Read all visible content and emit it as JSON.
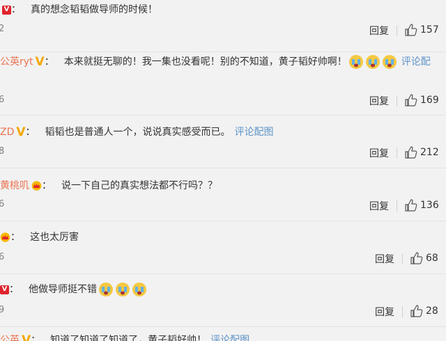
{
  "comments": [
    {
      "prefix": "",
      "badge": "red-v",
      "text": "真的想念韬韬做导师的时候！",
      "date": "2",
      "reply": "回复",
      "likes": "157"
    },
    {
      "prefix": "公英ryt",
      "badge": "v-check",
      "text": "本来就挺无聊的！我一集也没看呢！别的不知道，黄子韬好帅啊！",
      "emoji_count": 3,
      "pic_link": "评论配",
      "date": "6",
      "reply": "回复",
      "likes": "169"
    },
    {
      "prefix": "ZD",
      "badge": "v-check",
      "text": "韬韬也是普通人一个，说说真实感受而已。",
      "pic_link": "评论配图",
      "date": "8",
      "reply": "回复",
      "likes": "212"
    },
    {
      "prefix": "黄桃叽",
      "badge": "crown",
      "text": "说一下自己的真实想法都不行吗？？",
      "date": "6",
      "reply": "回复",
      "likes": "136"
    },
    {
      "prefix": "",
      "badge": "crown",
      "text": "这也太厉害",
      "date": "6",
      "reply": "回复",
      "likes": "68"
    },
    {
      "prefix": "",
      "badge": "red-v",
      "text": "他做导师挺不错",
      "emoji_count": 3,
      "date": "9",
      "reply": "回复",
      "likes": "28"
    }
  ],
  "partial_last": {
    "prefix": "公英",
    "text": "知道了知道了知道了，黄子韬好帅！",
    "pic_link": "评论配图"
  },
  "icons": {
    "like": "thumbs-up-icon",
    "emoji": "crying-face-icon",
    "crown": "crown-icon",
    "verified": "v-badge-icon"
  },
  "colors": {
    "username": "#eb7350",
    "link": "#5d93c8",
    "background": "#f2f2f2",
    "verified": "#f6a700"
  }
}
